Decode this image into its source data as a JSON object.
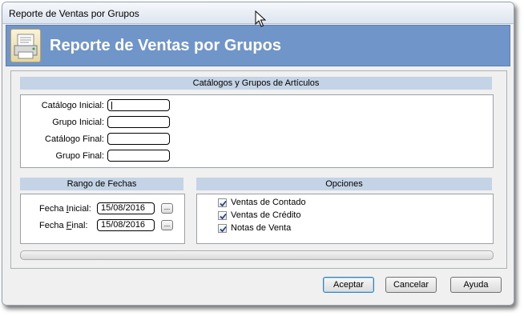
{
  "window": {
    "title": "Reporte de Ventas por Grupos"
  },
  "banner": {
    "heading": "Reporte de Ventas por Grupos",
    "icon": "report-printer-icon"
  },
  "catalogs_section": {
    "header": "Catálogos y Grupos de Artículos",
    "fields": [
      {
        "label": "Catálogo Inicial:",
        "value": ""
      },
      {
        "label": "Grupo Inicial:",
        "value": ""
      },
      {
        "label": "Catálogo Final:",
        "value": ""
      },
      {
        "label": "Grupo Final:",
        "value": ""
      }
    ]
  },
  "dates_section": {
    "header": "Rango de Fechas",
    "start": {
      "label_pre": "Fecha ",
      "label_u": "I",
      "label_post": "nicial:",
      "value": "15/08/2016",
      "button": "..."
    },
    "end": {
      "label_pre": "Fecha ",
      "label_u": "F",
      "label_post": "inal:",
      "value": "15/08/2016",
      "button": "..."
    }
  },
  "options_section": {
    "header": "Opciones",
    "items": [
      {
        "label": "Ventas de Contado",
        "checked": true
      },
      {
        "label": "Ventas de Crédito",
        "checked": true
      },
      {
        "label": "Notas de Venta",
        "checked": true
      }
    ]
  },
  "progress": {
    "value": 0
  },
  "buttons": {
    "accept": "Aceptar",
    "cancel": "Cancelar",
    "help": "Ayuda"
  }
}
